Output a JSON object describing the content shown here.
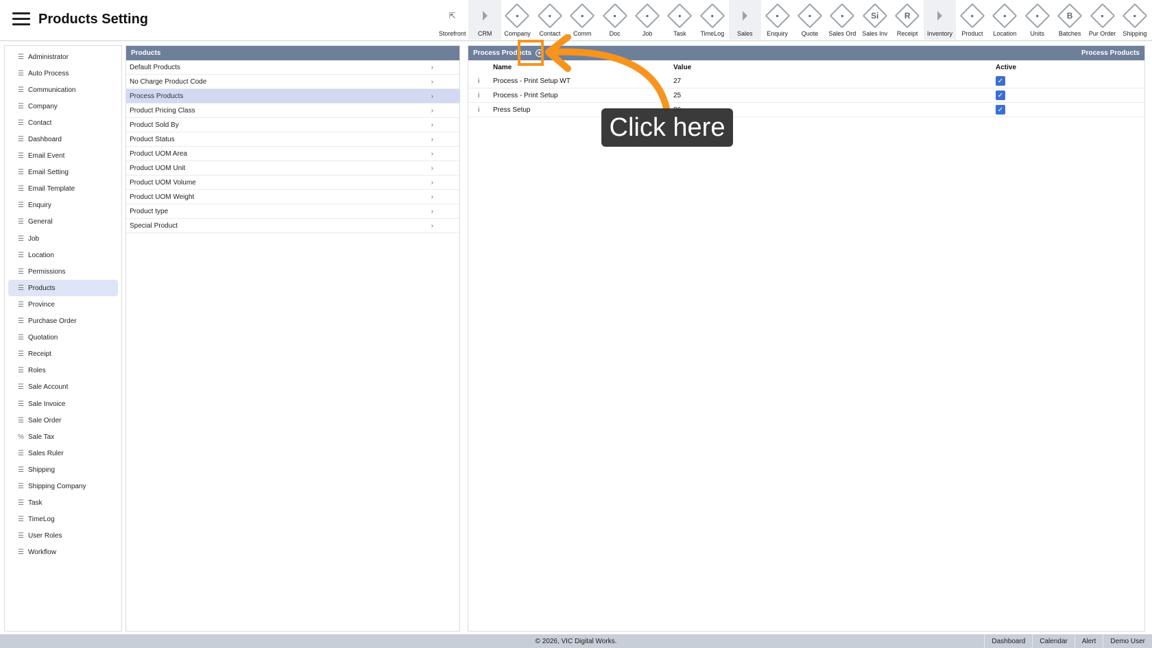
{
  "header": {
    "title": "Products Setting"
  },
  "toolbar": [
    {
      "label": "Storefront",
      "icon": "external-link-icon",
      "kind": "plain"
    },
    {
      "label": "CRM",
      "icon": "triangle-right-icon",
      "kind": "sep"
    },
    {
      "label": "Company",
      "icon": "company-icon",
      "kind": "diamond"
    },
    {
      "label": "Contact",
      "icon": "contact-icon",
      "kind": "diamond"
    },
    {
      "label": "Comm",
      "icon": "comm-icon",
      "kind": "diamond"
    },
    {
      "label": "Doc",
      "icon": "doc-icon",
      "kind": "diamond"
    },
    {
      "label": "Job",
      "icon": "job-icon",
      "kind": "diamond"
    },
    {
      "label": "Task",
      "icon": "task-icon",
      "kind": "diamond"
    },
    {
      "label": "TimeLog",
      "icon": "clock-icon",
      "kind": "diamond"
    },
    {
      "label": "Sales",
      "icon": "triangle-right-icon",
      "kind": "sep"
    },
    {
      "label": "Enquiry",
      "icon": "enquiry-icon",
      "kind": "diamond"
    },
    {
      "label": "Quote",
      "icon": "quote-icon",
      "kind": "diamond"
    },
    {
      "label": "Sales Ord",
      "icon": "sales-order-icon",
      "kind": "diamond"
    },
    {
      "label": "Sales Inv",
      "icon": "sales-invoice-icon",
      "kind": "diamond",
      "glyph": "Si"
    },
    {
      "label": "Receipt",
      "icon": "receipt-icon",
      "kind": "diamond",
      "glyph": "R"
    },
    {
      "label": "Inventory",
      "icon": "triangle-right-icon",
      "kind": "sep"
    },
    {
      "label": "Product",
      "icon": "product-icon",
      "kind": "diamond"
    },
    {
      "label": "Location",
      "icon": "location-icon",
      "kind": "diamond"
    },
    {
      "label": "Units",
      "icon": "units-icon",
      "kind": "diamond"
    },
    {
      "label": "Batches",
      "icon": "batches-icon",
      "kind": "diamond",
      "glyph": "B"
    },
    {
      "label": "Pur Order",
      "icon": "cart-icon",
      "kind": "diamond"
    },
    {
      "label": "Shipping",
      "icon": "truck-icon",
      "kind": "diamond"
    }
  ],
  "sidebar": {
    "items": [
      "Administrator",
      "Auto Process",
      "Communication",
      "Company",
      "Contact",
      "Dashboard",
      "Email Event",
      "Email Setting",
      "Email Template",
      "Enquiry",
      "General",
      "Job",
      "Location",
      "Permissions",
      "Products",
      "Province",
      "Purchase Order",
      "Quotation",
      "Receipt",
      "Roles",
      "Sale Account",
      "Sale Invoice",
      "Sale Order",
      "Sale Tax",
      "Sales Ruler",
      "Shipping",
      "Shipping Company",
      "Task",
      "TimeLog",
      "User Roles",
      "Workflow"
    ],
    "active": "Products"
  },
  "middle": {
    "title": "Products",
    "items": [
      "Default Products",
      "No Charge Product Code",
      "Process Products",
      "Product Pricing Class",
      "Product Sold By",
      "Product Status",
      "Product UOM Area",
      "Product UOM Unit",
      "Product UOM Volume",
      "Product UOM Weight",
      "Product type",
      "Special Product"
    ],
    "active": "Process Products"
  },
  "right": {
    "title": "Process Products",
    "title_right": "Process Products",
    "columns": {
      "name": "Name",
      "value": "Value",
      "active": "Active"
    },
    "rows": [
      {
        "info": "i",
        "name": "Process - Print Setup WT",
        "value": "27",
        "active": true
      },
      {
        "info": "i",
        "name": "Process - Print Setup",
        "value": "25",
        "active": true
      },
      {
        "info": "i",
        "name": "Press Setup",
        "value": "26",
        "active": true
      }
    ]
  },
  "callout": {
    "text": "Click here",
    "accent": "#f7941d"
  },
  "footer": {
    "copyright": "© 2026, VIC Digital Works.",
    "links": [
      "Dashboard",
      "Calendar",
      "Alert",
      "Demo User"
    ]
  }
}
